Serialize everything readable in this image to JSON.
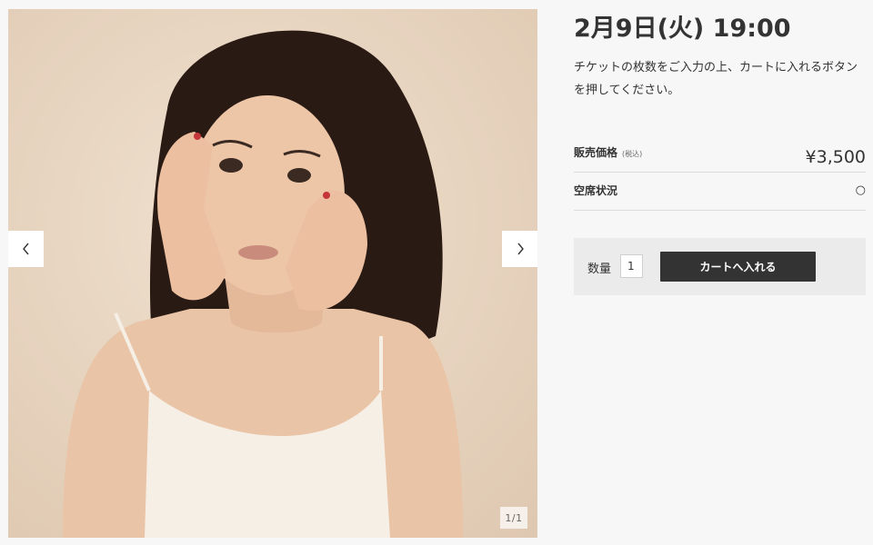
{
  "product": {
    "event_date": "2月9日(火) 19:00",
    "instructions": "チケットの枚数をご入力の上、カートに入れるボタンを押してください。",
    "price_label": "販売価格",
    "price_tax_note": "(税込)",
    "price_value": "¥3,500",
    "seats_label": "空席状況",
    "seats_status": "○"
  },
  "cart": {
    "quantity_label": "数量",
    "quantity_value": "1",
    "add_button_label": "カートへ入れる"
  },
  "gallery": {
    "counter": "1/1",
    "prev_icon": "chevron-left-icon",
    "next_icon": "chevron-right-icon"
  }
}
